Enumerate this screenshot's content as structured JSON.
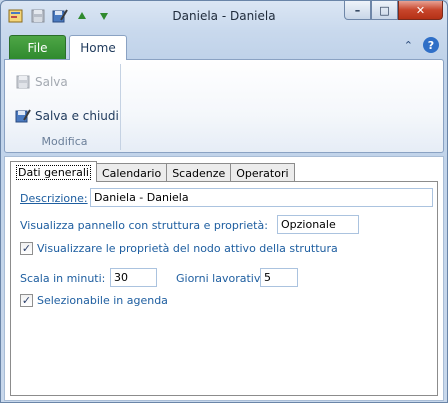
{
  "window": {
    "title": "Daniela - Daniela",
    "minimize": "–",
    "maximize": "□",
    "close": "✕"
  },
  "qat": {
    "icons": [
      "app-icon",
      "save-icon",
      "save-close-icon",
      "arrow-up-icon",
      "arrow-down-icon"
    ]
  },
  "ribbon": {
    "file_tab": "File",
    "home_tab": "Home",
    "collapse": "⌃",
    "help": "?",
    "group": {
      "label": "Modifica",
      "salva": "Salva",
      "salva_chiudi": "Salva e chiudi"
    }
  },
  "tabs": [
    "Dati generali",
    "Calendario",
    "Scadenze",
    "Operatori"
  ],
  "form": {
    "descrizione_label": "Descrizione:",
    "descrizione_value": "Daniela - Daniela",
    "pannello_label": "Visualizza pannello con struttura e proprietà:",
    "pannello_value": "Opzionale",
    "proprieta_label": "Visualizzare le proprietà del nodo attivo della struttura",
    "proprieta_checked": true,
    "scala_label": "Scala in minuti:",
    "scala_value": "30",
    "giorni_label": "Giorni lavorativi:",
    "giorni_value": "5",
    "agenda_label": "Selezionabile in agenda",
    "agenda_checked": true
  },
  "colors": {
    "file_tab": "#3a9638",
    "label_blue": "#1e5ea0",
    "close_button": "#c7452b"
  }
}
